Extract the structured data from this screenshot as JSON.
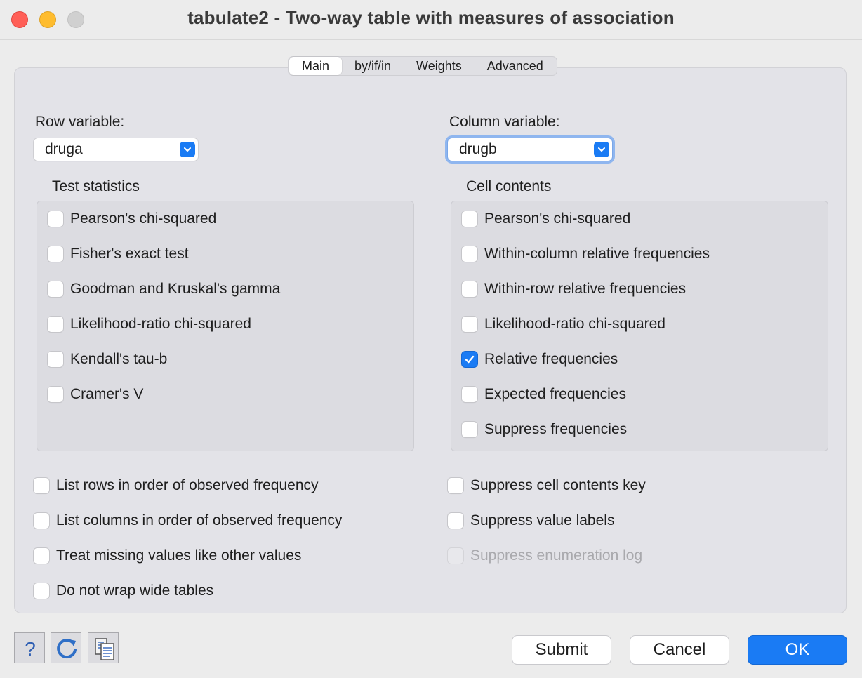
{
  "window": {
    "title": "tabulate2 - Two-way table with measures of association"
  },
  "tabs": [
    {
      "label": "Main",
      "active": true
    },
    {
      "label": "by/if/in",
      "active": false
    },
    {
      "label": "Weights",
      "active": false
    },
    {
      "label": "Advanced",
      "active": false
    }
  ],
  "row_variable": {
    "label": "Row variable:",
    "value": "druga"
  },
  "column_variable": {
    "label": "Column variable:",
    "value": "drugb"
  },
  "test_statistics": {
    "title": "Test statistics",
    "items": [
      {
        "label": "Pearson's chi-squared",
        "checked": false
      },
      {
        "label": "Fisher's exact test",
        "checked": false
      },
      {
        "label": "Goodman and Kruskal's gamma",
        "checked": false
      },
      {
        "label": "Likelihood-ratio chi-squared",
        "checked": false
      },
      {
        "label": "Kendall's tau-b",
        "checked": false
      },
      {
        "label": "Cramer's V",
        "checked": false
      }
    ]
  },
  "cell_contents": {
    "title": "Cell contents",
    "items": [
      {
        "label": "Pearson's chi-squared",
        "checked": false
      },
      {
        "label": "Within-column relative frequencies",
        "checked": false
      },
      {
        "label": "Within-row relative frequencies",
        "checked": false
      },
      {
        "label": "Likelihood-ratio chi-squared",
        "checked": false
      },
      {
        "label": "Relative frequencies",
        "checked": true
      },
      {
        "label": "Expected frequencies",
        "checked": false
      },
      {
        "label": "Suppress frequencies",
        "checked": false
      }
    ]
  },
  "options_left": [
    {
      "label": "List rows in order of observed frequency",
      "checked": false
    },
    {
      "label": "List columns in order of observed frequency",
      "checked": false
    },
    {
      "label": "Treat missing values like other values",
      "checked": false
    },
    {
      "label": "Do not wrap wide tables",
      "checked": false
    }
  ],
  "options_right": [
    {
      "label": "Suppress cell contents key",
      "checked": false,
      "disabled": false
    },
    {
      "label": "Suppress value labels",
      "checked": false,
      "disabled": false
    },
    {
      "label": "Suppress enumeration log",
      "checked": false,
      "disabled": true
    }
  ],
  "footer": {
    "help_icon": "question-mark-icon",
    "reset_icon": "refresh-icon",
    "copy_icon": "copy-command-icon",
    "submit_label": "Submit",
    "cancel_label": "Cancel",
    "ok_label": "OK"
  },
  "colors": {
    "accent": "#1a7bf4",
    "close": "#ff5f57",
    "minimize": "#febc2e",
    "maximize_inactive": "#d0d0d0"
  }
}
